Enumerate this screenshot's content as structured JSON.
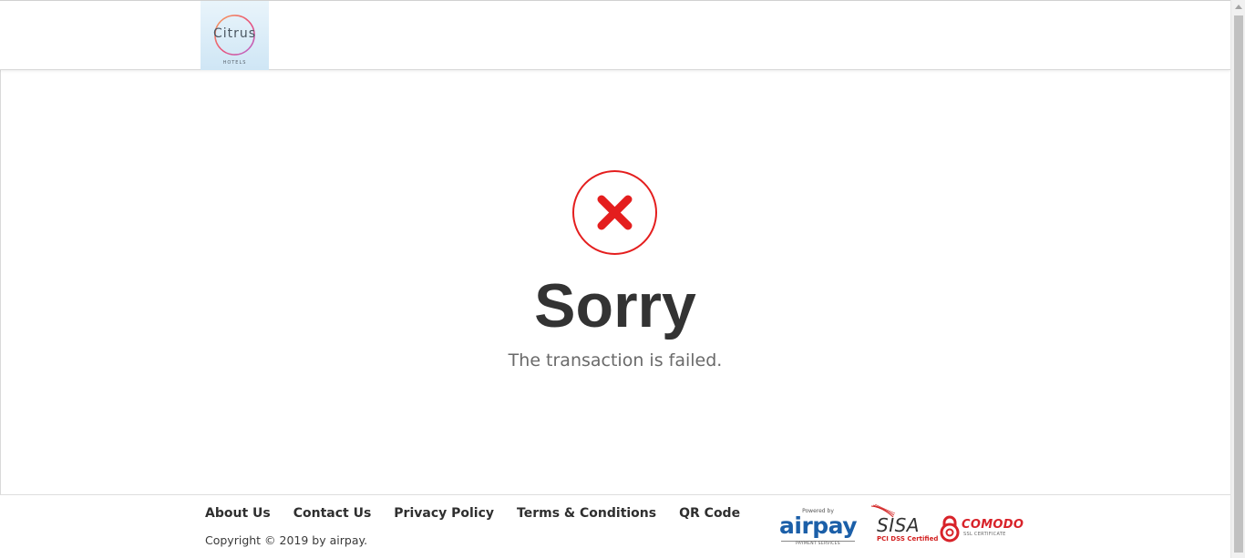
{
  "header": {
    "logo": {
      "word": "Citrus",
      "sub": "HOTELS",
      "ring_colors": [
        "#f7a35c",
        "#e8507a",
        "#b46ad6"
      ]
    }
  },
  "main": {
    "status_icon": {
      "name": "error-x-icon",
      "color": "#e41e1e"
    },
    "title": "Sorry",
    "message": "The transaction is failed."
  },
  "footer": {
    "links": [
      {
        "label": "About Us"
      },
      {
        "label": "Contact Us"
      },
      {
        "label": "Privacy Policy"
      },
      {
        "label": "Terms & Conditions"
      },
      {
        "label": "QR Code"
      }
    ],
    "copyright": "Copyright © 2019 by airpay.",
    "badges": {
      "airpay": {
        "powered": "Powered by",
        "word": "airpay",
        "sub": "PAYMENT SERVICES"
      },
      "sisa": {
        "word": "SISA",
        "sub": "PCI DSS Certified"
      },
      "comodo": {
        "word": "COMODO",
        "sub": "SSL CERTIFICATE"
      }
    }
  },
  "colors": {
    "accent_red": "#e41e1e",
    "title": "#333333",
    "airpay_blue": "#1b5fa8"
  }
}
